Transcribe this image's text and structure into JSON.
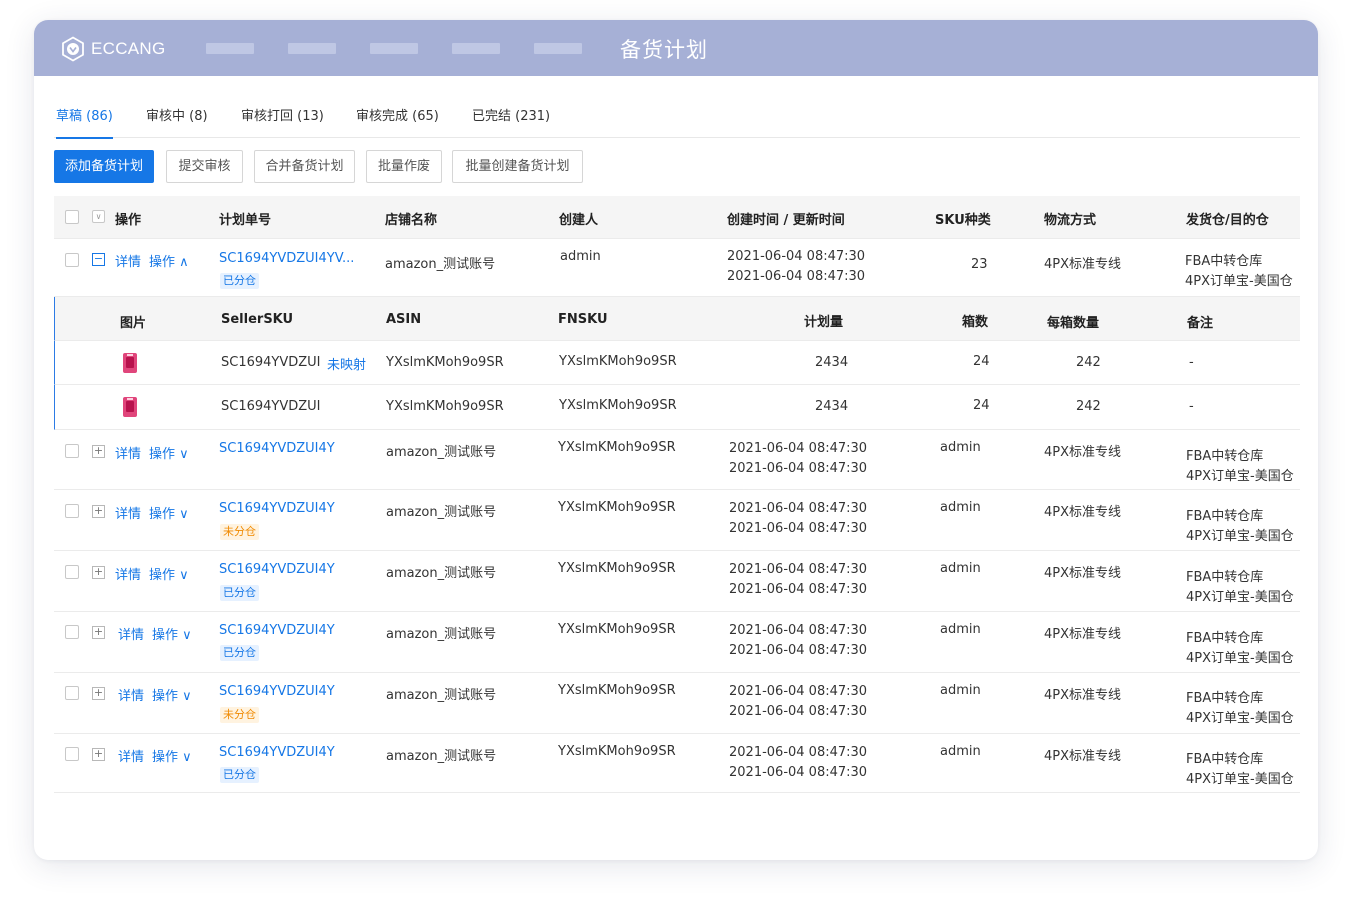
{
  "header": {
    "brand": "ECCANG",
    "page_title": "备货计划"
  },
  "tabs": [
    {
      "label": "草稿 (86)"
    },
    {
      "label": "审核中 (8)"
    },
    {
      "label": "审核打回 (13)"
    },
    {
      "label": "审核完成 (65)"
    },
    {
      "label": "已完结 (231)"
    }
  ],
  "toolbar": {
    "add": "添加备货计划",
    "submit": "提交审核",
    "merge": "合并备货计划",
    "void": "批量作废",
    "batch_create": "批量创建备货计划"
  },
  "columns": {
    "ops": "操作",
    "plan_no": "计划单号",
    "store": "店铺名称",
    "creator": "创建人",
    "time": "创建时间 / 更新时间",
    "sku_types": "SKU种类",
    "logistics": "物流方式",
    "warehouse": "发货仓/目的仓"
  },
  "row_actions": {
    "detail": "详情",
    "operate_open": "操作 ∧",
    "operate_closed": "操作 ∨"
  },
  "expanded_row": {
    "plan_no": "SC1694YVDZUI4YV...",
    "tag": "已分仓",
    "store": "amazon_测试账号",
    "creator": "admin",
    "created": "2021-06-04 08:47:30",
    "updated": "2021-06-04 08:47:30",
    "sku_types": "23",
    "logistics": "4PX标准专线",
    "warehouse_from": "FBA中转仓库",
    "warehouse_to": "4PX订单宝-美国仓"
  },
  "sub_columns": {
    "image": "图片",
    "seller_sku": "SellerSKU",
    "asin": "ASIN",
    "fnsku": "FNSKU",
    "plan_qty": "计划量",
    "boxes": "箱数",
    "per_box": "每箱数量",
    "note": "备注"
  },
  "sub_rows": [
    {
      "seller_sku": "SC1694YVDZUI",
      "unmapped": "未映射",
      "asin": "YXslmKMoh9o9SR",
      "fnsku": "YXslmKMoh9o9SR",
      "plan_qty": "2434",
      "boxes": "24",
      "per_box": "242",
      "note": "-"
    },
    {
      "seller_sku": "SC1694YVDZUI",
      "unmapped": "",
      "asin": "YXslmKMoh9o9SR",
      "fnsku": "YXslmKMoh9o9SR",
      "plan_qty": "2434",
      "boxes": "24",
      "per_box": "242",
      "note": "-"
    }
  ],
  "rows": [
    {
      "plan_no": "SC1694YVDZUI4Y",
      "tag": "",
      "store": "amazon_测试账号",
      "sku": "YXslmKMoh9o9SR",
      "created": "2021-06-04 08:47:30",
      "updated": "2021-06-04 08:47:30",
      "creator": "admin",
      "logistics": "4PX标准专线",
      "warehouse_from": "FBA中转仓库",
      "warehouse_to": "4PX订单宝-美国仓"
    },
    {
      "plan_no": "SC1694YVDZUI4Y",
      "tag": "未分仓",
      "store": "amazon_测试账号",
      "sku": "YXslmKMoh9o9SR",
      "created": "2021-06-04 08:47:30",
      "updated": "2021-06-04 08:47:30",
      "creator": "admin",
      "logistics": "4PX标准专线",
      "warehouse_from": "FBA中转仓库",
      "warehouse_to": "4PX订单宝-美国仓"
    },
    {
      "plan_no": "SC1694YVDZUI4Y",
      "tag": "已分仓",
      "store": "amazon_测试账号",
      "sku": "YXslmKMoh9o9SR",
      "created": "2021-06-04 08:47:30",
      "updated": "2021-06-04 08:47:30",
      "creator": "admin",
      "logistics": "4PX标准专线",
      "warehouse_from": "FBA中转仓库",
      "warehouse_to": "4PX订单宝-美国仓"
    },
    {
      "plan_no": "SC1694YVDZUI4Y",
      "tag": "已分仓",
      "store": "amazon_测试账号",
      "sku": "YXslmKMoh9o9SR",
      "created": "2021-06-04 08:47:30",
      "updated": "2021-06-04 08:47:30",
      "creator": "admin",
      "logistics": "4PX标准专线",
      "warehouse_from": "FBA中转仓库",
      "warehouse_to": "4PX订单宝-美国仓"
    },
    {
      "plan_no": "SC1694YVDZUI4Y",
      "tag": "未分仓",
      "store": "amazon_测试账号",
      "sku": "YXslmKMoh9o9SR",
      "created": "2021-06-04 08:47:30",
      "updated": "2021-06-04 08:47:30",
      "creator": "admin",
      "logistics": "4PX标准专线",
      "warehouse_from": "FBA中转仓库",
      "warehouse_to": "4PX订单宝-美国仓"
    },
    {
      "plan_no": "SC1694YVDZUI4Y",
      "tag": "已分仓",
      "store": "amazon_测试账号",
      "sku": "YXslmKMoh9o9SR",
      "created": "2021-06-04 08:47:30",
      "updated": "2021-06-04 08:47:30",
      "creator": "admin",
      "logistics": "4PX标准专线",
      "warehouse_from": "FBA中转仓库",
      "warehouse_to": "4PX订单宝-美国仓"
    }
  ],
  "colors": {
    "header_bg": "#a6b0d6",
    "accent": "#1677e6",
    "tag_blue_bg": "#e6f1ff",
    "tag_orange": "#f08a00"
  }
}
